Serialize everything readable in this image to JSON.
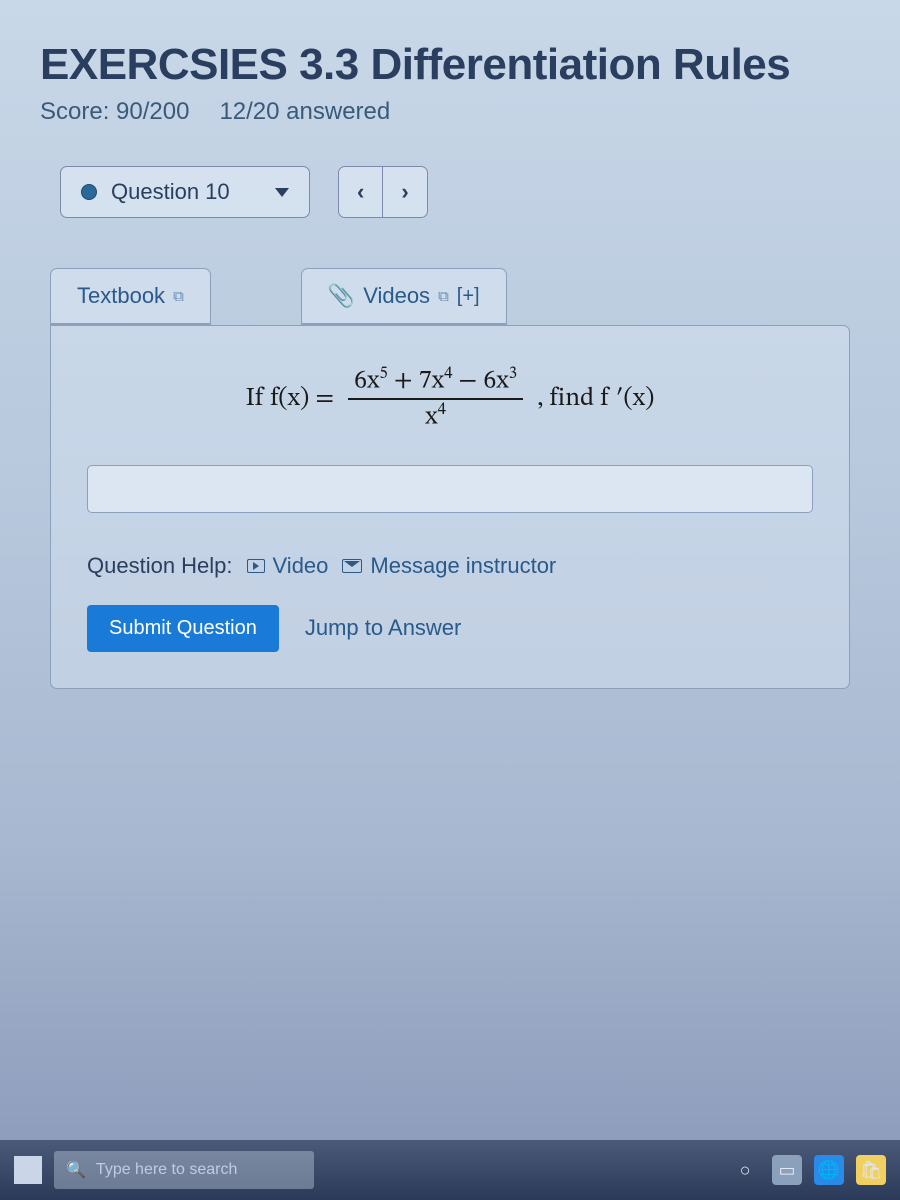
{
  "header": {
    "title": "EXERCSIES 3.3 Differentiation Rules",
    "score_label": "Score: 90/200",
    "answered_label": "12/20 answered"
  },
  "nav": {
    "question_label": "Question 10",
    "prev": "‹",
    "next": "›"
  },
  "tabs": {
    "textbook": "Textbook",
    "videos": "Videos",
    "expand": "[+]"
  },
  "problem": {
    "prefix": "If  f(x) =",
    "numerator_a": "6x",
    "numerator_a_exp": "5",
    "numerator_plus": " + 7x",
    "numerator_b_exp": "4",
    "numerator_minus": " − 6x",
    "numerator_c_exp": "3",
    "denominator_base": "x",
    "denominator_exp": "4",
    "suffix": ",  find  f ′(x)"
  },
  "help": {
    "label": "Question Help:",
    "video": "Video",
    "message": "Message instructor"
  },
  "actions": {
    "submit": "Submit Question",
    "jump": "Jump to Answer"
  },
  "taskbar": {
    "search_placeholder": "Type here to search"
  }
}
